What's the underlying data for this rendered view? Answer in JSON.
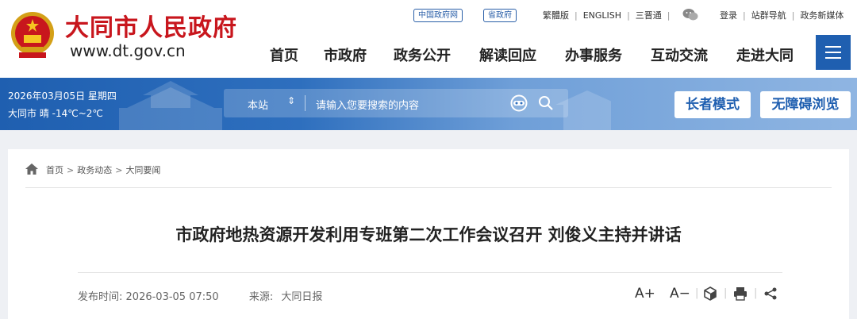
{
  "header": {
    "site_name": "大同市人民政府",
    "site_url": "www.dt.gov.cn",
    "pill_links": [
      "中国政府网",
      "省政府"
    ],
    "top_links": [
      "繁體版",
      "ENGLISH",
      "三晋通"
    ],
    "user_links": [
      "登录",
      "站群导航",
      "政务新媒体"
    ],
    "nav": [
      "首页",
      "市政府",
      "政务公开",
      "解读回应",
      "办事服务",
      "互动交流",
      "走进大同"
    ],
    "icons": {
      "emblem": "national-emblem-icon",
      "wechat": "wechat-icon",
      "menu": "hamburger-menu-icon"
    }
  },
  "banner": {
    "date": "2026年03月05日 星期四",
    "weather": "大同市 晴 -14℃~2℃",
    "search_scope": "本站",
    "search_placeholder": "请输入您要搜索的内容",
    "elder_mode": "长者模式",
    "accessible": "无障碍浏览",
    "icons": {
      "voice": "voice-search-icon",
      "search": "search-icon",
      "scope_arrow": "up-down-arrow-icon"
    }
  },
  "breadcrumb": [
    "首页",
    "政务动态",
    "大同要闻"
  ],
  "article": {
    "title": "市政府地热资源开发利用专班第二次工作会议召开 刘俊义主持并讲话",
    "publish_label": "发布时间:",
    "publish_time": "2026-03-05 07:50",
    "source_label": "来源:",
    "source": "大同日报"
  },
  "tools": {
    "font_up": "A+",
    "font_down": "A−",
    "icons": [
      "cube-icon",
      "print-icon",
      "share-icon"
    ]
  },
  "colors": {
    "brand_red": "#c8161d",
    "brand_blue": "#1f5fb0"
  }
}
